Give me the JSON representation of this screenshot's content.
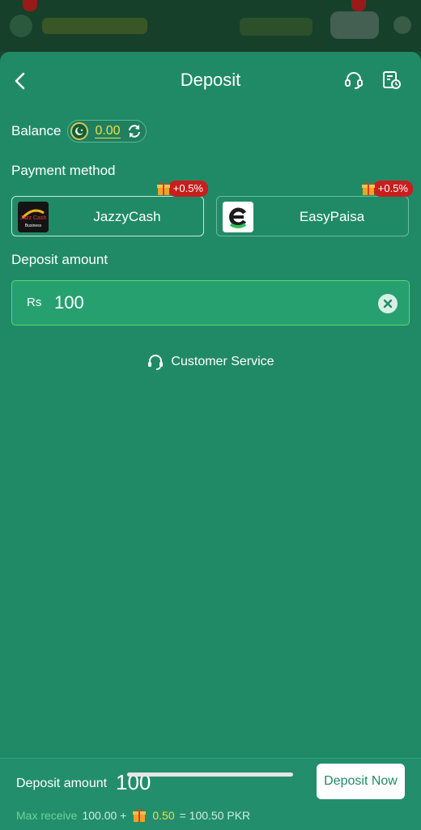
{
  "header": {
    "title": "Deposit"
  },
  "balance": {
    "label": "Balance",
    "value": "0.00"
  },
  "payment": {
    "label": "Payment method",
    "methods": [
      {
        "name": "JazzyCash",
        "bonus": "+0.5%",
        "logo_text": "Jazz Cash",
        "logo_sub": "Business"
      },
      {
        "name": "EasyPaisa",
        "bonus": "+0.5%"
      }
    ]
  },
  "deposit": {
    "label": "Deposit amount",
    "currency": "Rs",
    "value": "100"
  },
  "customer_service": {
    "label": "Customer Service"
  },
  "footer": {
    "deposit_label": "Deposit amount",
    "deposit_value": "100",
    "button_label": "Deposit Now",
    "max_label": "Max receive",
    "base": "100.00 +",
    "bonus": "0.50",
    "total": "= 100.50 PKR"
  },
  "colors": {
    "sheet_bg": "#208a67",
    "accent_yellow": "#f2de45",
    "badge_red": "#c81e1e",
    "input_border": "#57d67b"
  }
}
